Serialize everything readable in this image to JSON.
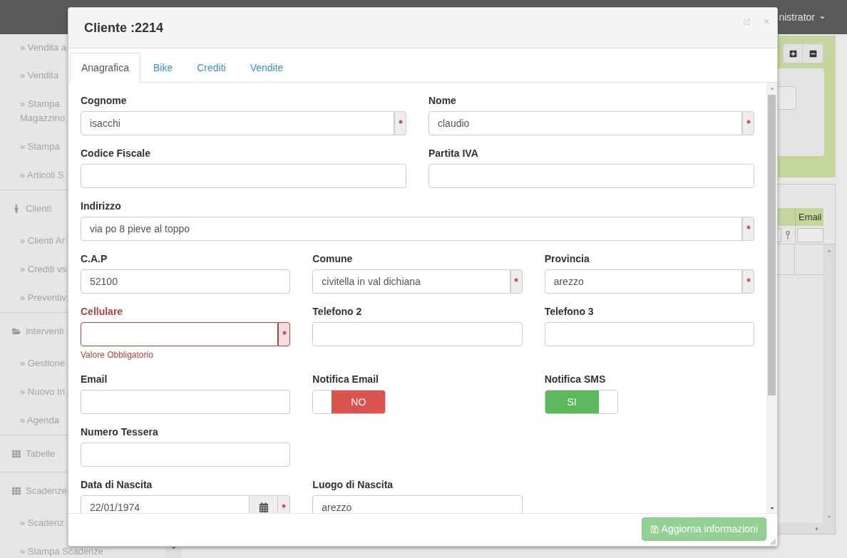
{
  "navbar": {
    "user_menu": "nistrator"
  },
  "sidebar": {
    "groups": [
      {
        "items": [
          "» Vendita a",
          "» Vendita",
          "» Stampa\nMagazzino",
          "» Stampa",
          "» Articoli S"
        ]
      },
      {
        "title": "Clienti",
        "items": [
          "» Clienti Ar",
          "» Crediti vs",
          "» Preventiv"
        ]
      },
      {
        "title": "Interventi",
        "items": [
          "» Gestione",
          "» Nuovo In",
          "» Agenda"
        ]
      },
      {
        "title": "Tabelle"
      },
      {
        "title": "Scadenze",
        "items": [
          "» Scadenz",
          "» Stampa Scadenze"
        ]
      }
    ]
  },
  "grid": {
    "columns": [
      "Email"
    ]
  },
  "dialog": {
    "title": "Cliente :2214",
    "tabs": [
      {
        "label": "Anagrafica",
        "selected": true
      },
      {
        "label": "Bike",
        "selected": false
      },
      {
        "label": "Crediti",
        "selected": false
      },
      {
        "label": "Vendite",
        "selected": false
      }
    ],
    "form": {
      "rows": [
        {
          "kind": "halves",
          "fields": [
            {
              "label": "Cognome",
              "kind": "text",
              "value": "isacchi",
              "required": true,
              "invalid": false
            },
            {
              "label": "Nome",
              "kind": "text",
              "value": "claudio",
              "required": true,
              "invalid": false
            }
          ]
        },
        {
          "kind": "halves",
          "fields": [
            {
              "label": "Codice Fiscale",
              "kind": "text",
              "required": false,
              "invalid": false
            },
            {
              "label": "Partita IVA",
              "kind": "text",
              "required": false,
              "invalid": false
            }
          ]
        },
        {
          "kind": "full",
          "fields": [
            {
              "label": "Indirizzo",
              "kind": "text",
              "value": "via po 8 pieve al toppo",
              "required": true,
              "invalid": false
            }
          ]
        },
        {
          "kind": "thirds",
          "fields": [
            {
              "label": "C.A.P",
              "kind": "text",
              "value": "52100",
              "required": false,
              "invalid": false
            },
            {
              "label": "Comune",
              "kind": "text",
              "value": "civitella in val dichiana",
              "required": true,
              "invalid": false
            },
            {
              "label": "Provincia",
              "kind": "text",
              "value": "arezzo",
              "required": true,
              "invalid": false
            }
          ]
        },
        {
          "kind": "thirds",
          "fields": [
            {
              "label": "Cellulare",
              "kind": "text",
              "required": true,
              "invalid": true,
              "error": "Valore Obbligatorio"
            },
            {
              "label": "Telefono 2",
              "kind": "text",
              "required": false,
              "invalid": false
            },
            {
              "label": "Telefono 3",
              "kind": "text",
              "required": false,
              "invalid": false
            }
          ]
        },
        {
          "kind": "thirds",
          "fields": [
            {
              "label": "Email",
              "kind": "text",
              "required": false,
              "invalid": false
            },
            {
              "label": "Notifica Email",
              "kind": "toggle",
              "on": false,
              "state_text": "NO"
            },
            {
              "label": "Notifica SMS",
              "kind": "toggle",
              "on": true,
              "state_text": "SI"
            }
          ]
        },
        {
          "kind": "thirds",
          "fields": [
            {
              "label": "Numero Tessera",
              "kind": "text",
              "required": false,
              "invalid": false
            }
          ]
        },
        {
          "kind": "thirds",
          "fields": [
            {
              "label": "Data di Nascita",
              "kind": "date",
              "value": "22/01/1974",
              "required": true,
              "invalid": false
            },
            {
              "label": "Luogo di Nascita",
              "kind": "text",
              "value": "arezzo",
              "required": false,
              "invalid": false
            }
          ]
        }
      ]
    },
    "footer": {
      "button": {
        "label": "Aggiorna informazioni",
        "disabled": true
      }
    }
  }
}
